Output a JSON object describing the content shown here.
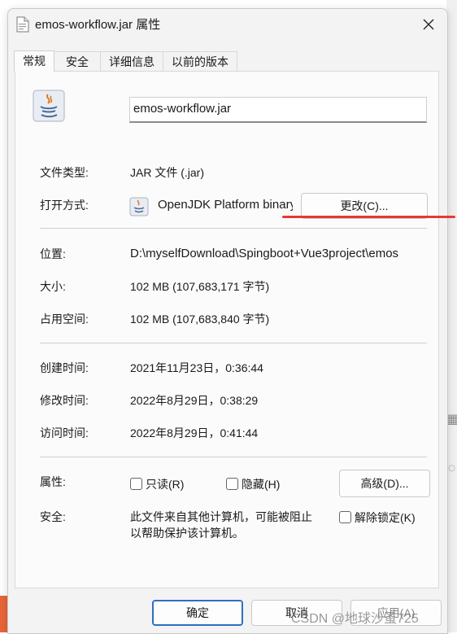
{
  "window": {
    "title": "emos-workflow.jar 属性"
  },
  "tabs": [
    {
      "label": "常规"
    },
    {
      "label": "安全"
    },
    {
      "label": "详细信息"
    },
    {
      "label": "以前的版本"
    }
  ],
  "general": {
    "file_name": "emos-workflow.jar",
    "type_label": "文件类型:",
    "type_value": "JAR 文件 (.jar)",
    "open_with_label": "打开方式:",
    "open_with_value": "OpenJDK Platform binary",
    "change_button": "更改(C)...",
    "location_label": "位置:",
    "location_value": "D:\\myselfDownload\\Spingboot+Vue3project\\emos",
    "size_label": "大小:",
    "size_value": "102 MB (107,683,171 字节)",
    "size_on_disk_label": "占用空间:",
    "size_on_disk_value": "102 MB (107,683,840 字节)",
    "created_label": "创建时间:",
    "created_value": "2021年11月23日，0:36:44",
    "modified_label": "修改时间:",
    "modified_value": "2022年8月29日，0:38:29",
    "accessed_label": "访问时间:",
    "accessed_value": "2022年8月29日，0:41:44",
    "attributes_label": "属性:",
    "readonly_label": "只读(R)",
    "hidden_label": "隐藏(H)",
    "advanced_button": "高级(D)...",
    "security_label": "安全:",
    "security_text_line1": "此文件来自其他计算机，可能被阻止",
    "security_text_line2": "以帮助保护该计算机。",
    "unblock_label": "解除锁定(K)"
  },
  "footer": {
    "ok_button": "确定",
    "cancel_button": "取消",
    "apply_button": "应用(A)"
  },
  "watermark": "CSDN @地球沙蚤725",
  "colors": {
    "accent": "#2f6fc1",
    "annotation_red": "#e53935",
    "dialog_bg": "#f3f3f3",
    "panel_bg": "#fbfbfb"
  }
}
